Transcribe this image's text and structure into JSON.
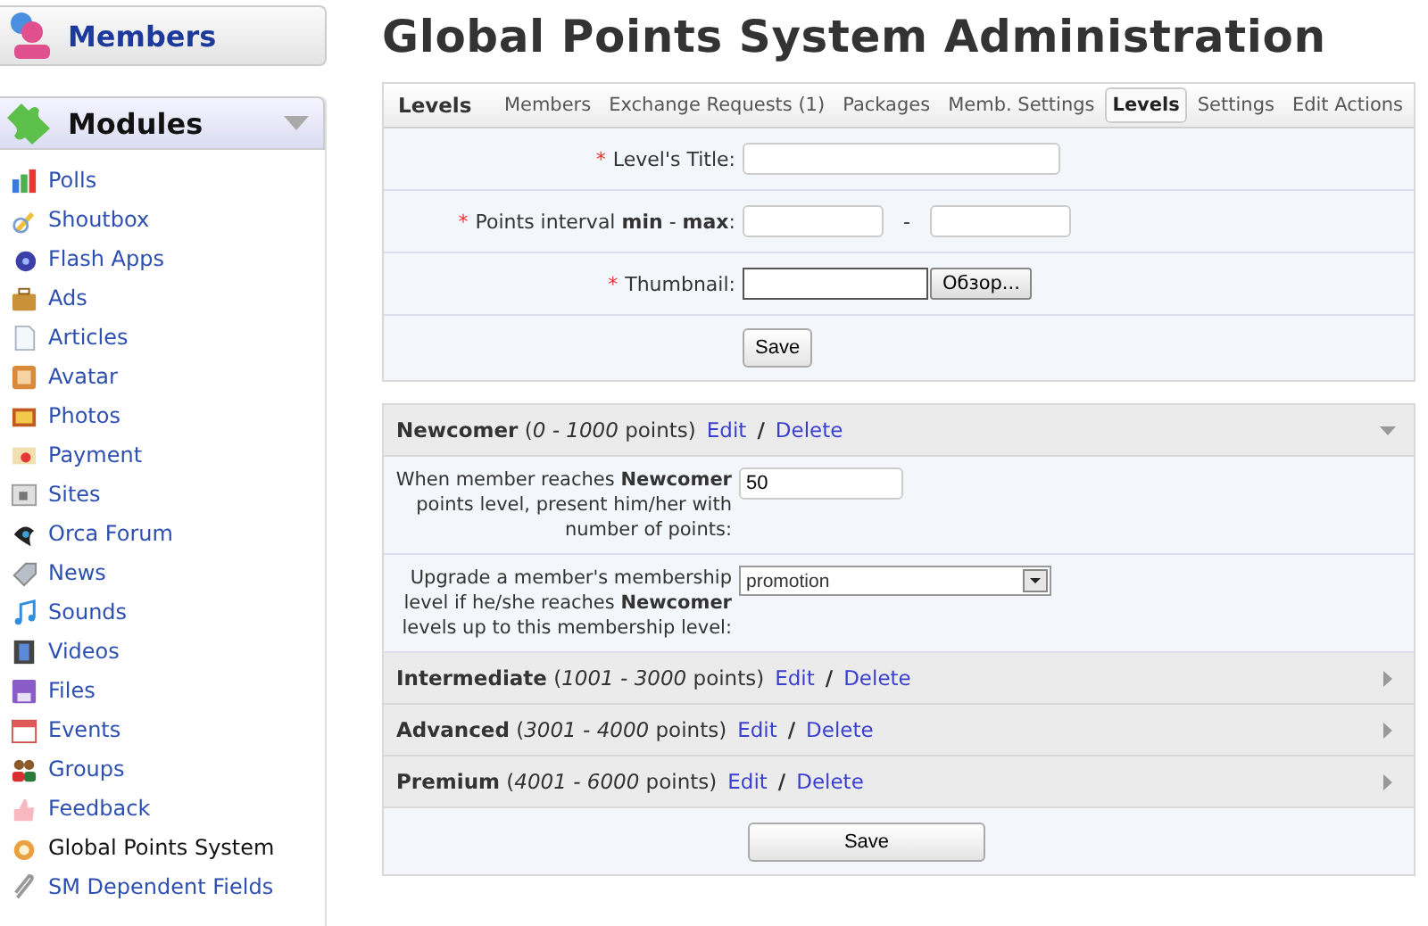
{
  "sidebar": {
    "members": {
      "title": "Members"
    },
    "modules": {
      "title": "Modules",
      "expanded": true,
      "items": [
        {
          "label": "Polls",
          "kind": "chart",
          "selected": false
        },
        {
          "label": "Shoutbox",
          "kind": "pencil",
          "selected": false
        },
        {
          "label": "Flash Apps",
          "kind": "disc",
          "selected": false
        },
        {
          "label": "Ads",
          "kind": "briefcase",
          "selected": false
        },
        {
          "label": "Articles",
          "kind": "document",
          "selected": false
        },
        {
          "label": "Avatar",
          "kind": "tile",
          "selected": false
        },
        {
          "label": "Photos",
          "kind": "photo",
          "selected": false
        },
        {
          "label": "Payment",
          "kind": "card",
          "selected": false
        },
        {
          "label": "Sites",
          "kind": "sheet",
          "selected": false
        },
        {
          "label": "Orca Forum",
          "kind": "fish",
          "selected": false
        },
        {
          "label": "News",
          "kind": "tag",
          "selected": false
        },
        {
          "label": "Sounds",
          "kind": "note",
          "selected": false
        },
        {
          "label": "Videos",
          "kind": "film",
          "selected": false
        },
        {
          "label": "Files",
          "kind": "floppy",
          "selected": false
        },
        {
          "label": "Events",
          "kind": "calendar",
          "selected": false
        },
        {
          "label": "Groups",
          "kind": "people",
          "selected": false
        },
        {
          "label": "Feedback",
          "kind": "thumb",
          "selected": false
        },
        {
          "label": "Global Points System",
          "kind": "coin",
          "selected": true
        },
        {
          "label": "SM Dependent Fields",
          "kind": "clip",
          "selected": false
        }
      ]
    }
  },
  "page_title": "Global Points System Administration",
  "levels_panel": {
    "title": "Levels",
    "tabs": [
      {
        "label": "Members",
        "selected": false
      },
      {
        "label": "Exchange Requests (1)",
        "selected": false
      },
      {
        "label": "Packages",
        "selected": false
      },
      {
        "label": "Memb. Settings",
        "selected": false
      },
      {
        "label": "Levels",
        "selected": true
      },
      {
        "label": "Settings",
        "selected": false
      },
      {
        "label": "Edit Actions",
        "selected": false
      }
    ],
    "rows": [
      {
        "kind": "text",
        "required_mark": "*",
        "label": "Level's Title:"
      },
      {
        "kind": "range",
        "required_mark": "*",
        "label": "Points interval **min** - **max**:",
        "separator": "-"
      },
      {
        "kind": "file",
        "required_mark": "*",
        "label": "Thumbnail:",
        "button": "Обзор..."
      }
    ],
    "submit": "Save"
  },
  "level_list": {
    "levels": [
      {
        "heading": "**Newcomer** (*0 - 1000* points)",
        "edit": "Edit",
        "separator": "/",
        "delete": "Delete",
        "expanded": true,
        "fields": [
          {
            "kind": "input",
            "label": "When member reaches **Newcomer** points level, present him/her with number of points:",
            "value": "50"
          },
          {
            "kind": "select",
            "label": "Upgrade a member's membership level if he/she reaches **Newcomer** levels up to this membership level:",
            "value": "promotion"
          }
        ]
      },
      {
        "heading": "**Intermediate** (*1001 - 3000* points)",
        "edit": "Edit",
        "separator": "/",
        "delete": "Delete",
        "expanded": false
      },
      {
        "heading": "**Advanced** (*3001 - 4000* points)",
        "edit": "Edit",
        "separator": "/",
        "delete": "Delete",
        "expanded": false
      },
      {
        "heading": "**Premium** (*4001 - 6000* points)",
        "edit": "Edit",
        "separator": "/",
        "delete": "Delete",
        "expanded": false
      }
    ],
    "save": "Save"
  }
}
